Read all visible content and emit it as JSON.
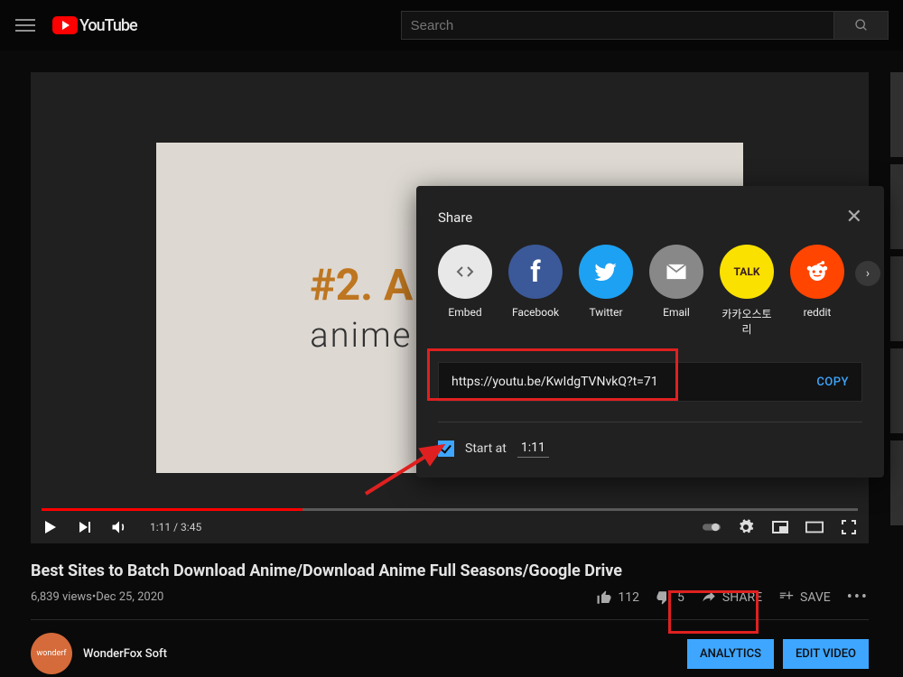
{
  "header": {
    "brand": "YouTube",
    "search_placeholder": "Search"
  },
  "video": {
    "overlay_line1": "#2. A",
    "overlay_line2": "anime",
    "time_current": "1:11",
    "time_total": "3:45"
  },
  "title": "Best Sites to Batch Download Anime/Download Anime Full Seasons/Google Drive",
  "stats": {
    "views": "6,839 views",
    "date": "Dec 25, 2020",
    "separator": " • "
  },
  "actions": {
    "likes": "112",
    "dislikes": "5",
    "share": "SHARE",
    "save": "SAVE"
  },
  "channel": {
    "name": "WonderFox Soft",
    "avatar_text": "wonderf",
    "btn_analytics": "ANALYTICS",
    "btn_edit": "EDIT VIDEO"
  },
  "share": {
    "title": "Share",
    "targets": {
      "embed": "Embed",
      "facebook": "Facebook",
      "twitter": "Twitter",
      "email": "Email",
      "kakao": "카카오스토리",
      "kakao_badge": "TALK",
      "reddit": "reddit"
    },
    "url": "https://youtu.be/KwIdgTVNvkQ?t=71",
    "copy": "COPY",
    "start_at_label": "Start at",
    "start_at_time": "1:11"
  }
}
